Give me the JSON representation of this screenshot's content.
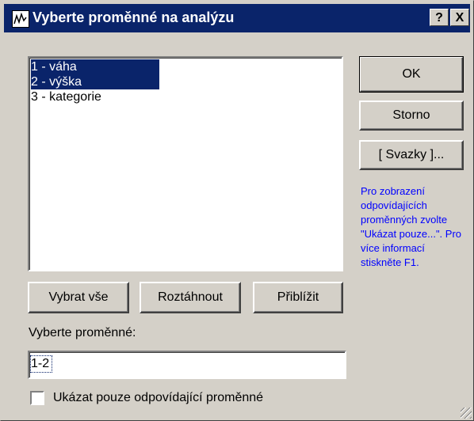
{
  "window": {
    "title": "Vyberte proměnné na analýzu",
    "help_button": "?",
    "close_button": "X"
  },
  "variable_list": {
    "items": [
      {
        "label": "1 - váha",
        "selected": true
      },
      {
        "label": "2 - výška",
        "selected": true
      },
      {
        "label": "3 - kategorie",
        "selected": false
      }
    ]
  },
  "buttons": {
    "ok": "OK",
    "cancel": "Storno",
    "bundles": "[ Svazky ]...",
    "select_all": "Vybrat vše",
    "expand": "Roztáhnout",
    "zoom": "Přiblížit"
  },
  "help_text": "Pro zobrazení odpovídajících proměnných zvolte \"Ukázat pouze...\". Pro více informací stiskněte F1.",
  "selection": {
    "label": "Vyberte proměnné:",
    "value": "1-2"
  },
  "show_only": {
    "label": "Ukázat pouze odpovídající proměnné",
    "checked": false
  },
  "colors": {
    "titlebar": "#0a246a",
    "dialog_bg": "#d4d0c8",
    "selection": "#0a246a",
    "help_text": "#0000ff"
  }
}
